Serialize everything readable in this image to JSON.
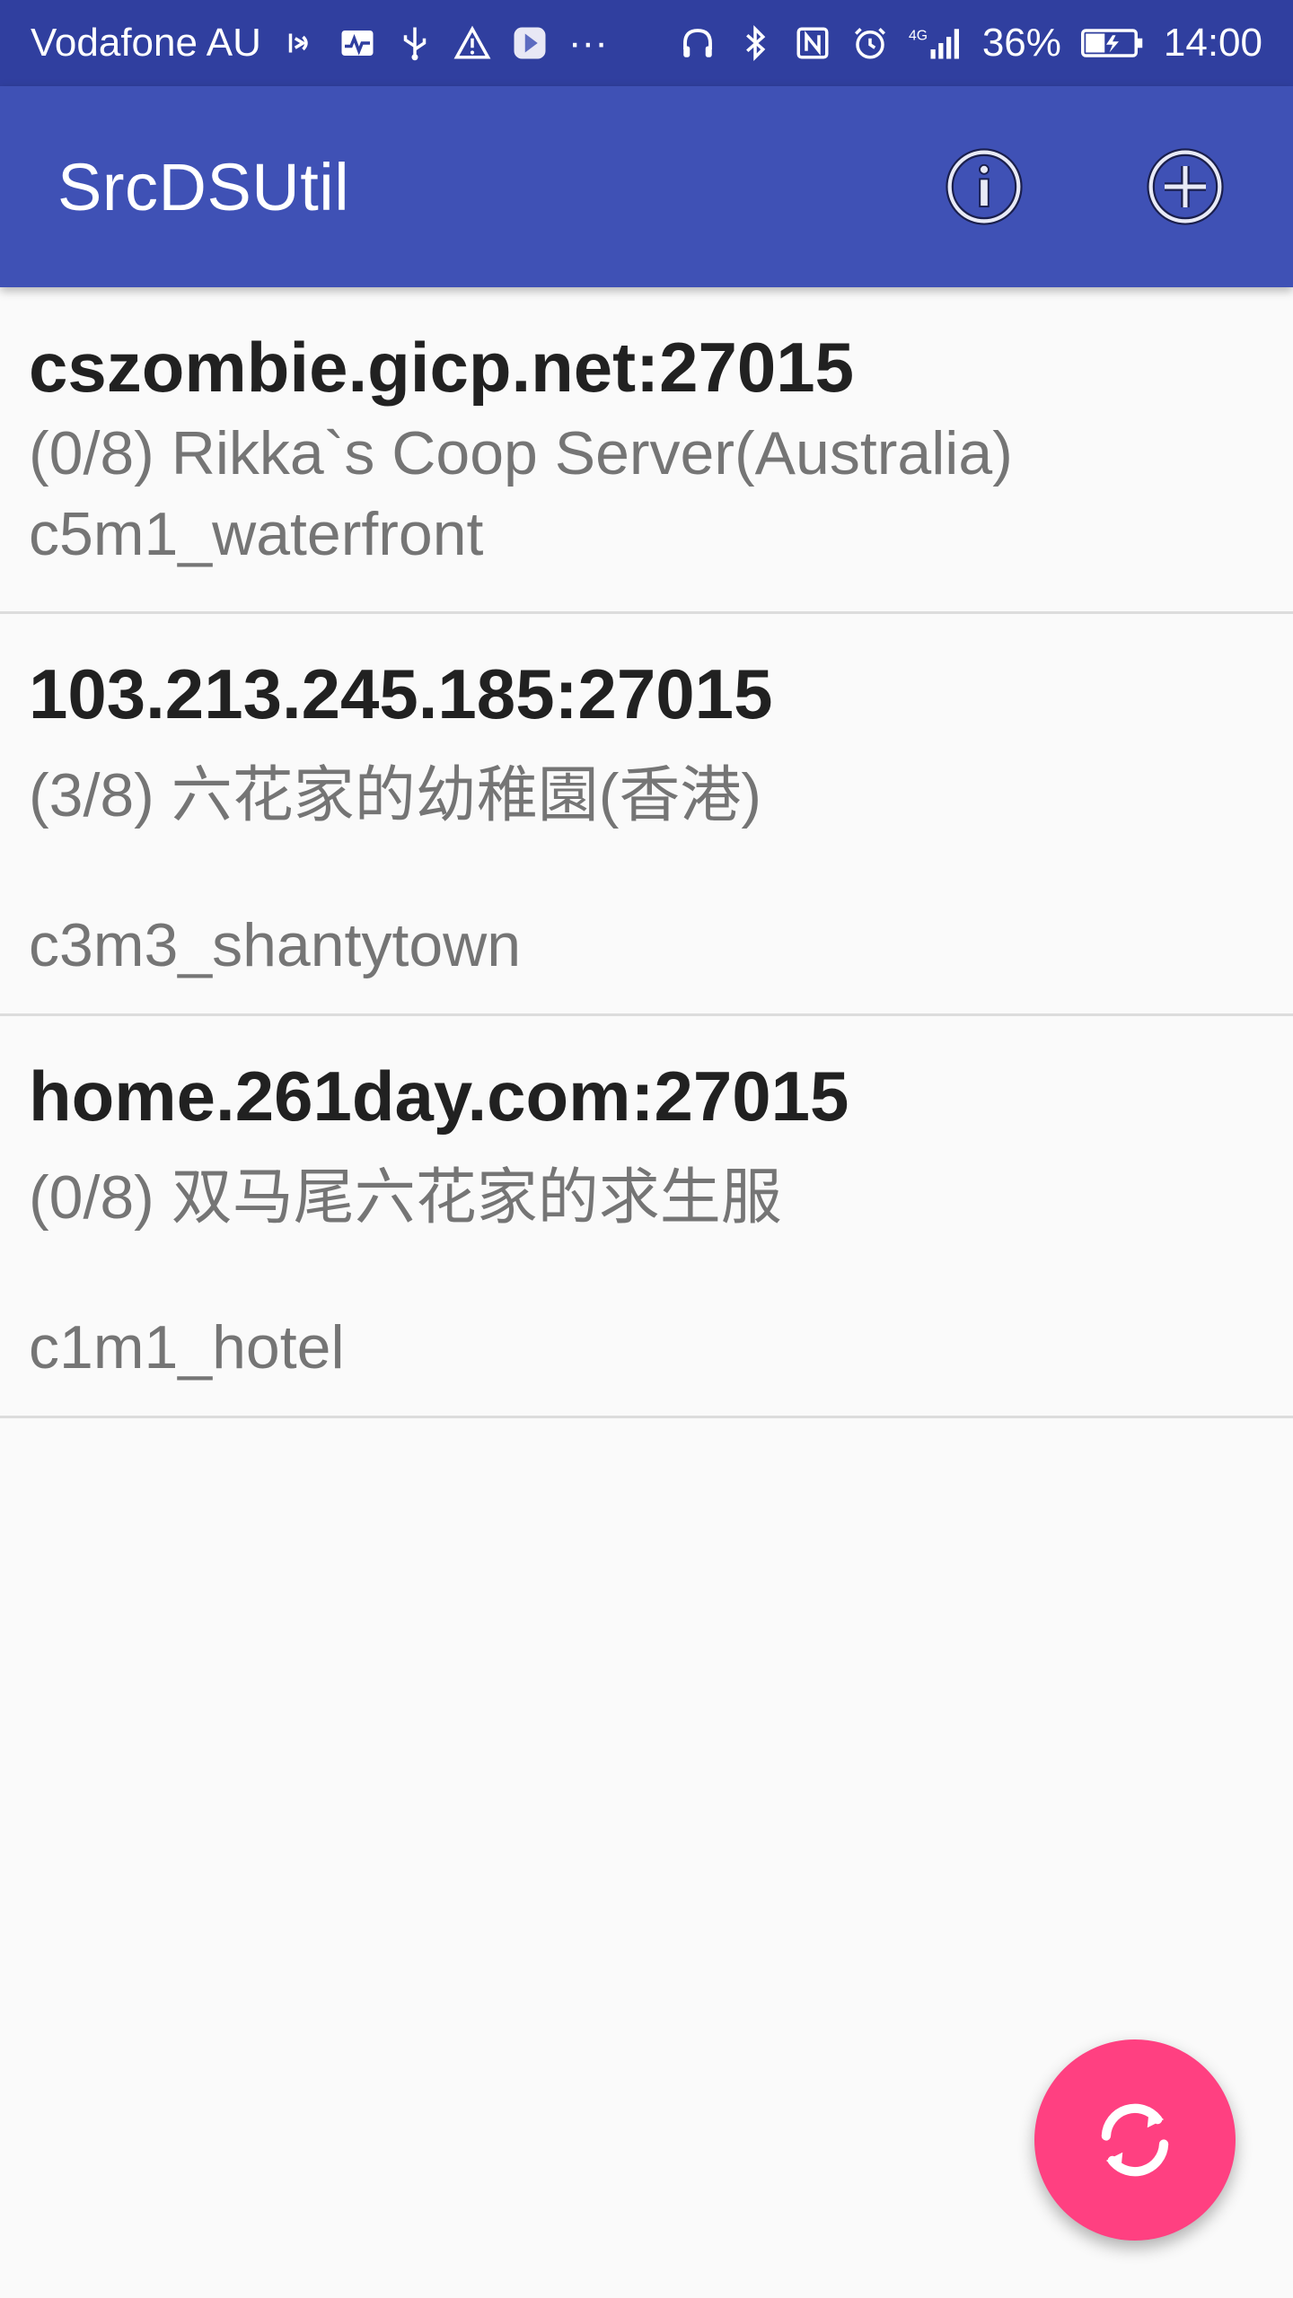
{
  "status_bar": {
    "carrier": "Vodafone AU",
    "battery": "36%",
    "time": "14:00",
    "network": "4G",
    "overflow": "···",
    "icons_left": [
      "nfc-signal-icon",
      "activity-icon",
      "usb-icon",
      "warning-icon",
      "media-app-icon",
      "more-icon"
    ],
    "icons_right": [
      "headphones-icon",
      "bluetooth-icon",
      "nfc-icon",
      "alarm-icon",
      "signal-icon",
      "battery-charging-icon"
    ]
  },
  "app_bar": {
    "title": "SrcDSUtil",
    "actions": [
      "info-icon",
      "add-icon"
    ]
  },
  "servers": [
    {
      "address": "cszombie.gicp.net:27015",
      "info": " (0/8) Rikka`s Coop Server(Australia)",
      "map": "c5m1_waterfront"
    },
    {
      "address": "103.213.245.185:27015",
      "info": " (3/8) 六花家的幼稚園(香港)",
      "map": "c3m3_shantytown"
    },
    {
      "address": "home.261day.com:27015",
      "info": " (0/8) 双马尾六花家的求生服",
      "map": "c1m1_hotel"
    }
  ],
  "fab": {
    "icon": "refresh-icon"
  },
  "colors": {
    "status_bar": "#303f9f",
    "app_bar": "#3f51b5",
    "fab": "#ff4081",
    "background": "#fafafa"
  }
}
